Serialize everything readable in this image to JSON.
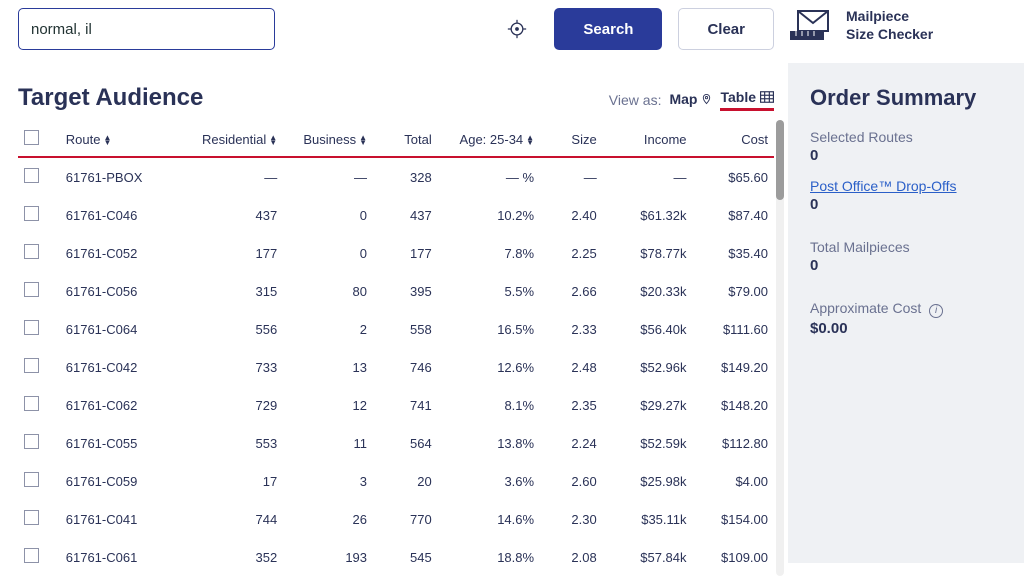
{
  "search": {
    "value": "normal, il",
    "search_btn": "Search",
    "clear_btn": "Clear"
  },
  "sizecheck": {
    "line1": "Mailpiece",
    "line2": "Size Checker"
  },
  "heading": "Target Audience",
  "viewas": {
    "label": "View as:",
    "map": "Map",
    "table": "Table"
  },
  "columns": {
    "route": "Route",
    "res": "Residential",
    "bus": "Business",
    "tot": "Total",
    "age": "Age: 25-34",
    "size": "Size",
    "inc": "Income",
    "cost": "Cost"
  },
  "rows": [
    {
      "route": "61761-PBOX",
      "res": "—",
      "bus": "—",
      "tot": "328",
      "age": "— %",
      "size": "—",
      "inc": "—",
      "cost": "$65.60"
    },
    {
      "route": "61761-C046",
      "res": "437",
      "bus": "0",
      "tot": "437",
      "age": "10.2%",
      "size": "2.40",
      "inc": "$61.32k",
      "cost": "$87.40"
    },
    {
      "route": "61761-C052",
      "res": "177",
      "bus": "0",
      "tot": "177",
      "age": "7.8%",
      "size": "2.25",
      "inc": "$78.77k",
      "cost": "$35.40"
    },
    {
      "route": "61761-C056",
      "res": "315",
      "bus": "80",
      "tot": "395",
      "age": "5.5%",
      "size": "2.66",
      "inc": "$20.33k",
      "cost": "$79.00"
    },
    {
      "route": "61761-C064",
      "res": "556",
      "bus": "2",
      "tot": "558",
      "age": "16.5%",
      "size": "2.33",
      "inc": "$56.40k",
      "cost": "$111.60"
    },
    {
      "route": "61761-C042",
      "res": "733",
      "bus": "13",
      "tot": "746",
      "age": "12.6%",
      "size": "2.48",
      "inc": "$52.96k",
      "cost": "$149.20"
    },
    {
      "route": "61761-C062",
      "res": "729",
      "bus": "12",
      "tot": "741",
      "age": "8.1%",
      "size": "2.35",
      "inc": "$29.27k",
      "cost": "$148.20"
    },
    {
      "route": "61761-C055",
      "res": "553",
      "bus": "11",
      "tot": "564",
      "age": "13.8%",
      "size": "2.24",
      "inc": "$52.59k",
      "cost": "$112.80"
    },
    {
      "route": "61761-C059",
      "res": "17",
      "bus": "3",
      "tot": "20",
      "age": "3.6%",
      "size": "2.60",
      "inc": "$25.98k",
      "cost": "$4.00"
    },
    {
      "route": "61761-C041",
      "res": "744",
      "bus": "26",
      "tot": "770",
      "age": "14.6%",
      "size": "2.30",
      "inc": "$35.11k",
      "cost": "$154.00"
    },
    {
      "route": "61761-C061",
      "res": "352",
      "bus": "193",
      "tot": "545",
      "age": "18.8%",
      "size": "2.08",
      "inc": "$57.84k",
      "cost": "$109.00"
    }
  ],
  "summary": {
    "title": "Order Summary",
    "sel_routes_lbl": "Selected Routes",
    "sel_routes_val": "0",
    "dropoff_lbl": "Post Office™ Drop-Offs",
    "dropoff_val": "0",
    "mailpieces_lbl": "Total Mailpieces",
    "mailpieces_val": "0",
    "cost_lbl": "Approximate Cost",
    "cost_val": "$0.00"
  }
}
